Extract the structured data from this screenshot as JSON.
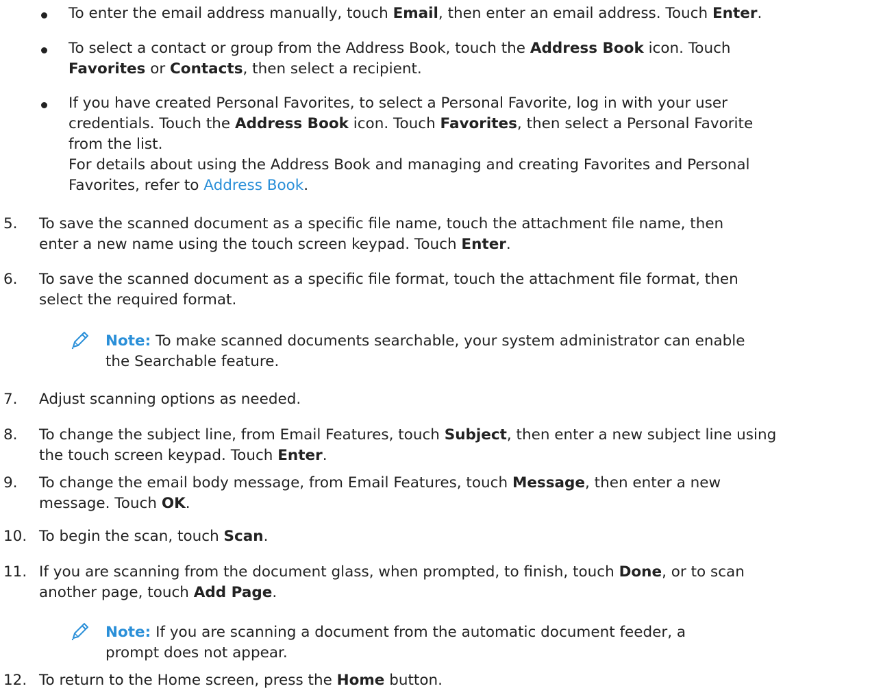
{
  "bullets": [
    {
      "parts": [
        {
          "t": "To enter the email address manually, touch "
        },
        {
          "t": "Email",
          "b": true
        },
        {
          "t": ", then enter an email address. Touch "
        },
        {
          "t": "Enter",
          "b": true
        },
        {
          "t": "."
        }
      ]
    },
    {
      "line1": [
        {
          "t": "To select a contact or group from the Address Book, touch the "
        },
        {
          "t": "Address Book",
          "b": true
        },
        {
          "t": " icon. Touch"
        }
      ],
      "line2": [
        {
          "t": "Favorites",
          "b": true
        },
        {
          "t": " or "
        },
        {
          "t": "Contacts",
          "b": true
        },
        {
          "t": ", then select a recipient."
        }
      ]
    },
    {
      "line1": [
        {
          "t": "If you have created Personal Favorites, to select a Personal Favorite, log in with your user"
        }
      ],
      "line2": [
        {
          "t": "credentials. Touch the "
        },
        {
          "t": "Address Book",
          "b": true
        },
        {
          "t": " icon. Touch "
        },
        {
          "t": "Favorites",
          "b": true
        },
        {
          "t": ", then select a Personal Favorite"
        }
      ],
      "line3": [
        {
          "t": "from the list."
        }
      ],
      "line4": [
        {
          "t": "For details about using the Address Book and managing and creating Favorites and Personal"
        }
      ],
      "line5_before": "Favorites, refer to ",
      "line5_link": "Address Book",
      "line5_after": "."
    }
  ],
  "steps": [
    {
      "num": "5.",
      "line1": [
        {
          "t": "To save the scanned document as a specific file name, touch the attachment file name, then"
        }
      ],
      "line2": [
        {
          "t": "enter a new name using the touch screen keypad. Touch "
        },
        {
          "t": "Enter",
          "b": true
        },
        {
          "t": "."
        }
      ]
    },
    {
      "num": "6.",
      "line1": [
        {
          "t": "To save the scanned document as a specific file format, touch the attachment file format, then"
        }
      ],
      "line2": [
        {
          "t": "select the required format."
        }
      ]
    },
    {
      "num": "7.",
      "line1": [
        {
          "t": "Adjust scanning options as needed."
        }
      ]
    },
    {
      "num": "8.",
      "line1": [
        {
          "t": "To change the subject line, from Email Features, touch "
        },
        {
          "t": "Subject",
          "b": true
        },
        {
          "t": ", then enter a new subject line using"
        }
      ],
      "line2": [
        {
          "t": "the touch screen keypad. Touch "
        },
        {
          "t": "Enter",
          "b": true
        },
        {
          "t": "."
        }
      ]
    },
    {
      "num": "9.",
      "line1": [
        {
          "t": "To change the email body message, from Email Features, touch "
        },
        {
          "t": "Message",
          "b": true
        },
        {
          "t": ", then enter a new"
        }
      ],
      "line2": [
        {
          "t": "message. Touch "
        },
        {
          "t": "OK",
          "b": true
        },
        {
          "t": "."
        }
      ]
    },
    {
      "num": "10.",
      "line1": [
        {
          "t": "To begin the scan, touch "
        },
        {
          "t": "Scan",
          "b": true
        },
        {
          "t": "."
        }
      ]
    },
    {
      "num": "11.",
      "line1": [
        {
          "t": "If you are scanning from the document glass, when prompted, to finish, touch "
        },
        {
          "t": "Done",
          "b": true
        },
        {
          "t": ", or to scan"
        }
      ],
      "line2": [
        {
          "t": "another page, touch "
        },
        {
          "t": "Add Page",
          "b": true
        },
        {
          "t": "."
        }
      ]
    },
    {
      "num": "12.",
      "line1": [
        {
          "t": "To return to the Home screen, press the "
        },
        {
          "t": "Home",
          "b": true
        },
        {
          "t": " button."
        }
      ]
    }
  ],
  "notes": [
    {
      "label": "Note:",
      "line1": " To make scanned documents searchable, your system administrator can enable",
      "line2": "the Searchable feature."
    },
    {
      "label": "Note:",
      "line1": " If you are scanning a document from the automatic document feeder, a",
      "line2": "prompt does not appear."
    }
  ],
  "colors": {
    "accent": "#2a8fd8",
    "text": "#222222"
  },
  "icons": {
    "note": "pencil-icon"
  }
}
